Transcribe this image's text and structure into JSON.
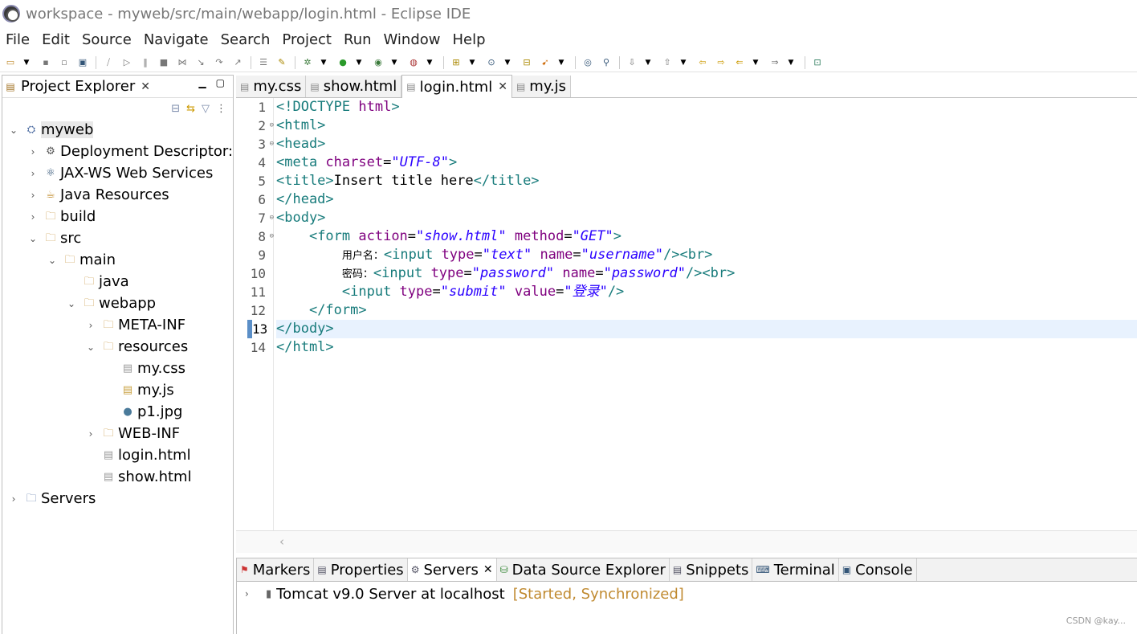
{
  "window": {
    "title": "workspace - myweb/src/main/webapp/login.html - Eclipse IDE"
  },
  "menu": [
    "File",
    "Edit",
    "Source",
    "Navigate",
    "Search",
    "Project",
    "Run",
    "Window",
    "Help"
  ],
  "project_explorer": {
    "tab_label": "Project Explorer",
    "tree": [
      {
        "label": "myweb",
        "depth": 0,
        "state": "open",
        "icon": "project-icon",
        "selected": true
      },
      {
        "label": "Deployment Descriptor:",
        "depth": 1,
        "state": "closed",
        "icon": "descriptor-icon"
      },
      {
        "label": "JAX-WS Web Services",
        "depth": 1,
        "state": "closed",
        "icon": "webservices-icon"
      },
      {
        "label": "Java Resources",
        "depth": 1,
        "state": "closed",
        "icon": "java-resources-icon"
      },
      {
        "label": "build",
        "depth": 1,
        "state": "closed",
        "icon": "folder-icon"
      },
      {
        "label": "src",
        "depth": 1,
        "state": "open",
        "icon": "folder-icon"
      },
      {
        "label": "main",
        "depth": 2,
        "state": "open",
        "icon": "folder-icon"
      },
      {
        "label": "java",
        "depth": 3,
        "state": "none",
        "icon": "folder-icon"
      },
      {
        "label": "webapp",
        "depth": 3,
        "state": "open",
        "icon": "folder-icon"
      },
      {
        "label": "META-INF",
        "depth": 4,
        "state": "closed",
        "icon": "folder-icon"
      },
      {
        "label": "resources",
        "depth": 4,
        "state": "open",
        "icon": "folder-icon"
      },
      {
        "label": "my.css",
        "depth": 5,
        "state": "none",
        "icon": "css-file-icon"
      },
      {
        "label": "my.js",
        "depth": 5,
        "state": "none",
        "icon": "js-file-icon"
      },
      {
        "label": "p1.jpg",
        "depth": 5,
        "state": "none",
        "icon": "image-file-icon"
      },
      {
        "label": "WEB-INF",
        "depth": 4,
        "state": "closed",
        "icon": "folder-icon"
      },
      {
        "label": "login.html",
        "depth": 4,
        "state": "none",
        "icon": "html-file-icon"
      },
      {
        "label": "show.html",
        "depth": 4,
        "state": "none",
        "icon": "html-file-icon"
      },
      {
        "label": "Servers",
        "depth": 0,
        "state": "closed",
        "icon": "servers-folder-icon"
      }
    ]
  },
  "editor": {
    "tabs": [
      {
        "label": "my.css",
        "active": false
      },
      {
        "label": "show.html",
        "active": false
      },
      {
        "label": "login.html",
        "active": true
      },
      {
        "label": "my.js",
        "active": false
      }
    ],
    "line_numbers": [
      "1",
      "2",
      "3",
      "4",
      "5",
      "6",
      "7",
      "8",
      "9",
      "10",
      "11",
      "12",
      "13",
      "14"
    ],
    "fold_markers": [
      "",
      "⊖",
      "⊖",
      "",
      "",
      "",
      "⊖",
      "⊖",
      "",
      "",
      "",
      "",
      "",
      ""
    ],
    "highlighted_line": 13,
    "lines": [
      [
        [
          "tg",
          "<!DOCTYPE "
        ],
        [
          "at",
          "html"
        ],
        [
          "tg",
          ">"
        ]
      ],
      [
        [
          "tg",
          "<html>"
        ]
      ],
      [
        [
          "tg",
          "<head>"
        ]
      ],
      [
        [
          "tg",
          "<meta "
        ],
        [
          "at",
          "charset"
        ],
        [
          "tx",
          "="
        ],
        [
          "av",
          "\"UTF-8\""
        ],
        [
          "tg",
          ">"
        ]
      ],
      [
        [
          "tg",
          "<title>"
        ],
        [
          "tx",
          "Insert title here"
        ],
        [
          "tg",
          "</title>"
        ]
      ],
      [
        [
          "tg",
          "</head>"
        ]
      ],
      [
        [
          "tg",
          "<body>"
        ]
      ],
      [
        [
          "tx",
          "    "
        ],
        [
          "tg",
          "<form "
        ],
        [
          "at",
          "action"
        ],
        [
          "tx",
          "="
        ],
        [
          "av",
          "\"show.html\""
        ],
        [
          "tx",
          " "
        ],
        [
          "at",
          "method"
        ],
        [
          "tx",
          "="
        ],
        [
          "av",
          "\"GET\""
        ],
        [
          "tg",
          ">"
        ]
      ],
      [
        [
          "tx",
          "        "
        ],
        [
          "cjk",
          "用户名："
        ],
        [
          "tg",
          "<input "
        ],
        [
          "at",
          "type"
        ],
        [
          "tx",
          "="
        ],
        [
          "av",
          "\"text\""
        ],
        [
          "tx",
          " "
        ],
        [
          "at",
          "name"
        ],
        [
          "tx",
          "="
        ],
        [
          "av",
          "\"username\""
        ],
        [
          "tg",
          "/><br>"
        ]
      ],
      [
        [
          "tx",
          "        "
        ],
        [
          "cjk",
          "密码："
        ],
        [
          "tg",
          "<input "
        ],
        [
          "at",
          "type"
        ],
        [
          "tx",
          "="
        ],
        [
          "av",
          "\"password\""
        ],
        [
          "tx",
          " "
        ],
        [
          "at",
          "name"
        ],
        [
          "tx",
          "="
        ],
        [
          "av",
          "\"password\""
        ],
        [
          "tg",
          "/><br>"
        ]
      ],
      [
        [
          "tx",
          "        "
        ],
        [
          "tg",
          "<input "
        ],
        [
          "at",
          "type"
        ],
        [
          "tx",
          "="
        ],
        [
          "av",
          "\"submit\""
        ],
        [
          "tx",
          " "
        ],
        [
          "at",
          "value"
        ],
        [
          "tx",
          "="
        ],
        [
          "av",
          "\"登录\""
        ],
        [
          "tg",
          "/>"
        ]
      ],
      [
        [
          "tx",
          "    "
        ],
        [
          "tg",
          "</form>"
        ]
      ],
      [
        [
          "tg",
          "</body>"
        ]
      ],
      [
        [
          "tg",
          "</html>"
        ]
      ]
    ]
  },
  "bottom_panel": {
    "tabs": [
      {
        "label": "Markers",
        "icon": "markers-icon",
        "active": false
      },
      {
        "label": "Properties",
        "icon": "properties-icon",
        "active": false
      },
      {
        "label": "Servers",
        "icon": "servers-icon",
        "active": true
      },
      {
        "label": "Data Source Explorer",
        "icon": "data-source-icon",
        "active": false
      },
      {
        "label": "Snippets",
        "icon": "snippets-icon",
        "active": false
      },
      {
        "label": "Terminal",
        "icon": "terminal-icon",
        "active": false
      },
      {
        "label": "Console",
        "icon": "console-icon",
        "active": false
      }
    ],
    "server": {
      "name": "Tomcat v9.0 Server at localhost",
      "status": "[Started, Synchronized]"
    }
  },
  "watermark": "CSDN @kay..."
}
